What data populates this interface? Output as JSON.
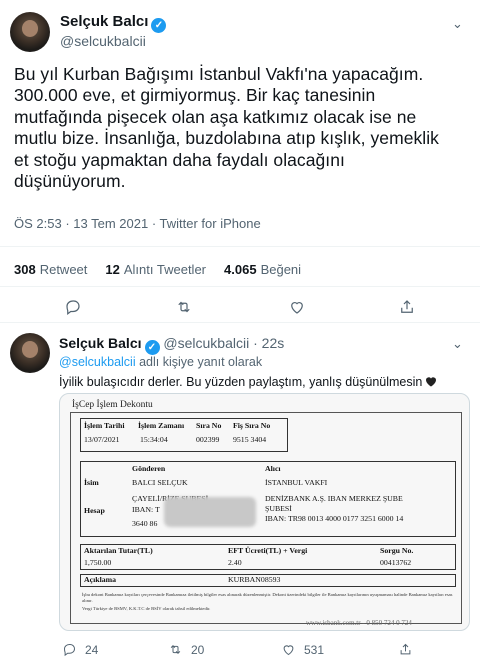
{
  "main_tweet": {
    "author_name": "Selçuk Balcı",
    "author_handle": "@selcukbalcii",
    "text": "Bu yıl Kurban Bağışımı İstanbul Vakfı'na yapacağım.\n300.000 eve, et girmiyormuş. Bir kaç tanesinin\nmutfağında pişecek olan aşa katkımız olacak ise ne\nmutlu bize. İnsanlığa, buzdolabına atıp kışlık, yemeklik\net stoğu yapmaktan daha faydalı olacağını\ndüşünüyorum.",
    "time": "ÖS 2:53",
    "date": "13 Tem 2021",
    "source": "Twitter for iPhone",
    "retweets": "308",
    "retweets_label": "Retweet",
    "quotes": "12",
    "quotes_label": "Alıntı Tweetler",
    "likes": "4.065",
    "likes_label": "Beğeni"
  },
  "reply_tweet": {
    "author_name": "Selçuk Balcı",
    "author_handle": "@selcukbalcii",
    "age": "22s",
    "reply_to_handle": "@selcukbalcii",
    "reply_to_suffix": "adlı kişiye yanıt olarak",
    "text": "İyilik bulaşıcıdır derler. Bu yüzden paylaştım, yanlış düşünülmesin",
    "reply_count": "24",
    "retweet_count": "20",
    "like_count": "531"
  },
  "receipt": {
    "title": "İşCep İşlem Dekontu",
    "h_date": "İşlem Tarihi",
    "h_time": "İşlem Zamanı",
    "h_seq": "Sıra No",
    "h_slip": "Fiş Sıra No",
    "v_date": "13/07/2021",
    "v_time": "15:34:04",
    "v_seq": "002399",
    "v_slip": "9515 3404",
    "sender_label": "Gönderen",
    "receiver_label": "Alıcı",
    "name_label": "İsim",
    "account_label": "Hesap",
    "sender_name": "BALCI SELÇUK",
    "receiver_name": "İSTANBUL VAKFI",
    "sender_branch": "ÇAYELİ/RİZE ŞUBESİ",
    "sender_iban_prefix": "IBAN: T",
    "sender_account_suffix": "3640 86",
    "receiver_bank": "DENİZBANK A.Ş. IBAN MERKEZ ŞUBE",
    "receiver_branch": "ŞUBESİ",
    "receiver_iban": "IBAN: TR98 0013 4000 0177 3251 6000 14",
    "amount_label": "Aktarılan Tutar(TL)",
    "fee_label": "EFT Ücreti(TL) + Vergi",
    "query_label": "Sorgu No.",
    "amount": "1,750.00",
    "fee": "2.40",
    "query_no": "00413762",
    "desc_label": "Açıklama",
    "desc": "KURBAN08593",
    "footer1": "İşbu dekont Bankamız kayıtları çerçevesinde Bankamıza iletilmiş bilgiler esas alınarak düzenlenmiştir. Dekont üzerindeki bilgiler ile Bankamız kayıtlarının uyuşmaması halinde Bankamız kayıtları esas alınır.",
    "footer2": "Vergi Türkiye de BSMV, K.K.T.C de BSİV olarak tahsil edilmektedir.",
    "footer_web": "www.isbank.com.tr - 0 850 724 0 724"
  }
}
